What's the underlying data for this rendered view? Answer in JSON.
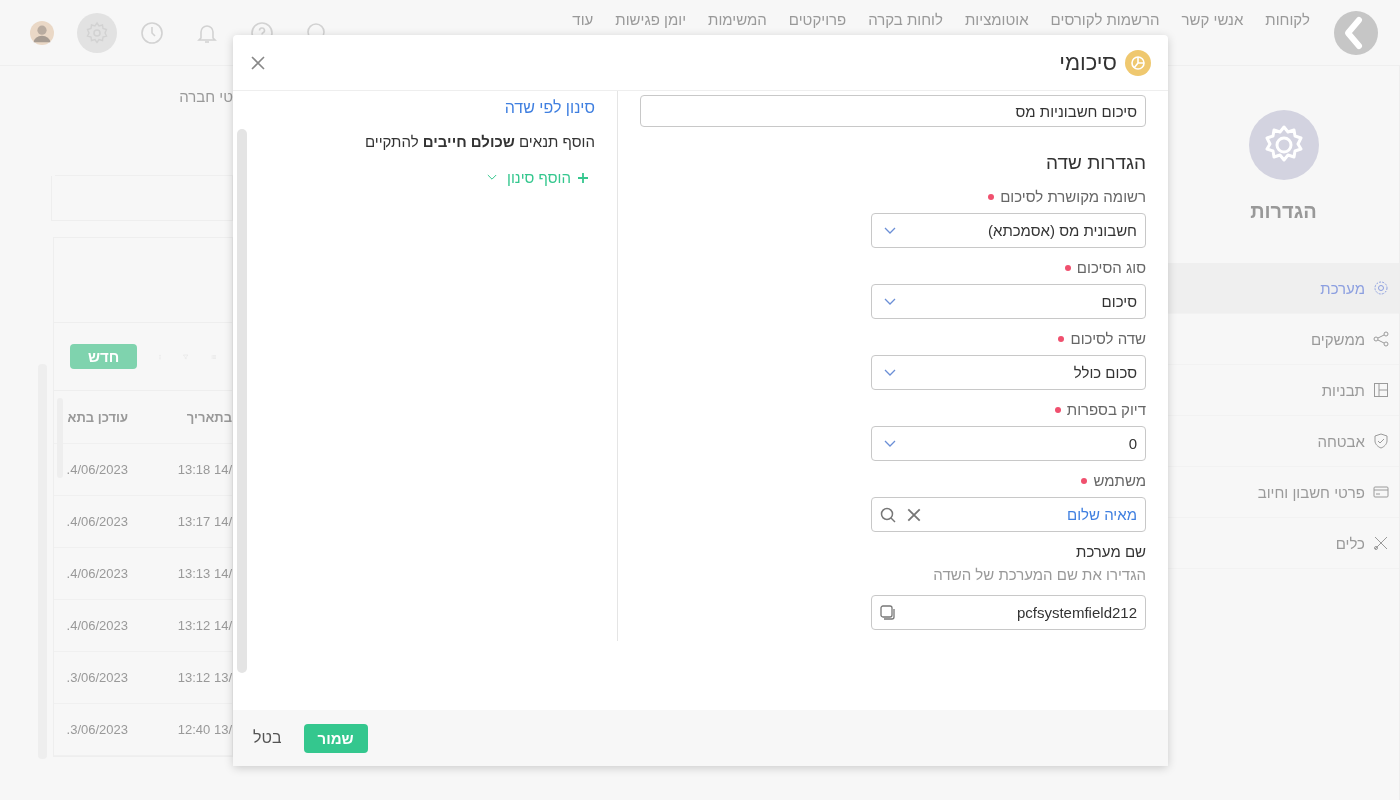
{
  "topbar": {
    "nav": [
      "לקוחות",
      "אנשי קשר",
      "הרשמות לקורסים",
      "אוטומציות",
      "לוחות בקרה",
      "פרויקטים",
      "המשימות",
      "יומן פגישות",
      "עוד"
    ],
    "icons": [
      {
        "kind": "search",
        "selected": false
      },
      {
        "kind": "help",
        "selected": false
      },
      {
        "kind": "bell",
        "selected": false
      },
      {
        "kind": "clock",
        "selected": false
      },
      {
        "kind": "settings",
        "selected": true
      },
      {
        "kind": "avatar",
        "selected": false
      }
    ]
  },
  "sidebar": {
    "title": "הגדרות",
    "items": [
      {
        "label": "מערכת",
        "kind": "gear",
        "selected": true
      },
      {
        "label": "ממשקים",
        "kind": "share",
        "selected": false
      },
      {
        "label": "תבניות",
        "kind": "layout",
        "selected": false
      },
      {
        "label": "אבטחה",
        "kind": "shield",
        "selected": false
      },
      {
        "label": "פרטי חשבון וחיוב",
        "kind": "card",
        "selected": false
      },
      {
        "label": "כלים",
        "kind": "tools",
        "selected": false
      }
    ]
  },
  "background": {
    "heading": "טי חברה",
    "new_button": "חדש",
    "columns": [
      "בתאריך",
      "עודכן בתא"
    ],
    "rows": [
      [
        "13:18 14/",
        ".4/06/2023"
      ],
      [
        "13:17 14/",
        ".4/06/2023"
      ],
      [
        "13:13 14/",
        ".4/06/2023"
      ],
      [
        "13:12 14/",
        ".4/06/2023"
      ],
      [
        "13:12 13/",
        ".3/06/2023"
      ],
      [
        "12:40 13/",
        ".3/06/2023"
      ]
    ]
  },
  "dialog": {
    "title": "סיכומי",
    "name_value": "סיכום חשבוניות מס",
    "section_title": "הגדרות שדה",
    "fields": [
      {
        "kind": "select",
        "label": "רשומה מקושרת לסיכום",
        "required": true,
        "value": "חשבונית מס (אסמכתא)"
      },
      {
        "kind": "select",
        "label": "סוג הסיכום",
        "required": true,
        "value": "סיכום"
      },
      {
        "kind": "select",
        "label": "שדה לסיכום",
        "required": true,
        "value": "סכום כולל"
      },
      {
        "kind": "select",
        "label": "דיוק בספרות",
        "required": true,
        "value": "0"
      },
      {
        "kind": "lookup",
        "label": "משתמש",
        "required": true,
        "value": "מאיה שלום"
      },
      {
        "kind": "copy",
        "label": "שם מערכת",
        "required": false,
        "hint": "הגדירו את שם המערכת של השדה",
        "value": "pcfsystemfield212"
      }
    ],
    "filter": {
      "title": "סינון לפי שדה",
      "description": "הוסף תנאים **שכולם חייבים** להתקיים",
      "add_button": "הוסף סינון"
    },
    "cancel": "בטל",
    "save": "שמור"
  }
}
